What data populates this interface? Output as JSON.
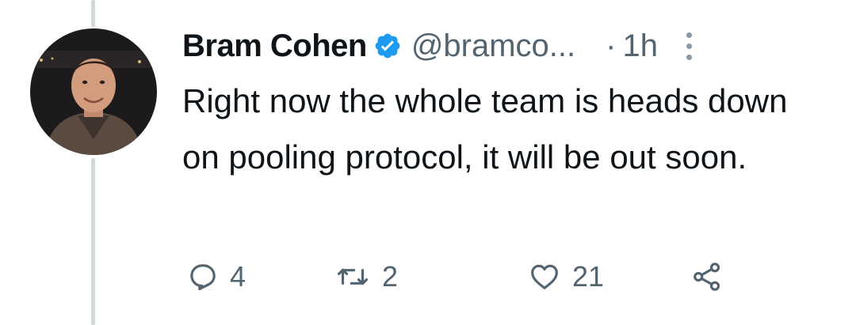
{
  "tweet": {
    "author_name": "Bram Cohen",
    "handle": "@bramco...",
    "separator": "·",
    "time": "1h",
    "text": "Right now the whole team is heads down on pooling protocol, it will be out soon.",
    "verified": true
  },
  "actions": {
    "reply_count": "4",
    "retweet_count": "2",
    "like_count": "21"
  },
  "colors": {
    "text": "#0f1419",
    "secondary": "#536471",
    "verified_blue": "#1d9bf0",
    "thread_line": "#cfd9de"
  },
  "icons": {
    "reply": "reply-icon",
    "retweet": "retweet-icon",
    "like": "heart-icon",
    "share": "share-icon",
    "verified": "verified-badge-icon",
    "more": "more-options-icon"
  }
}
